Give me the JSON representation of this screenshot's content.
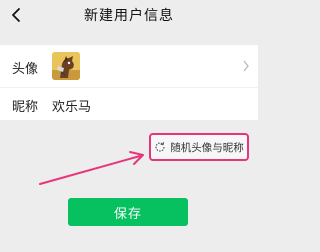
{
  "header": {
    "title": "新建用户信息",
    "back_icon": "back-chevron-icon"
  },
  "profile": {
    "avatar_label": "头像",
    "avatar_icon": "avatar-image",
    "nickname_label": "昵称",
    "nickname_value": "欢乐马"
  },
  "random_button": {
    "label": "随机头像与昵称",
    "icon": "refresh-icon",
    "highlight_color": "#e8347b"
  },
  "save_button": {
    "label": "保存",
    "color": "#07c160"
  }
}
